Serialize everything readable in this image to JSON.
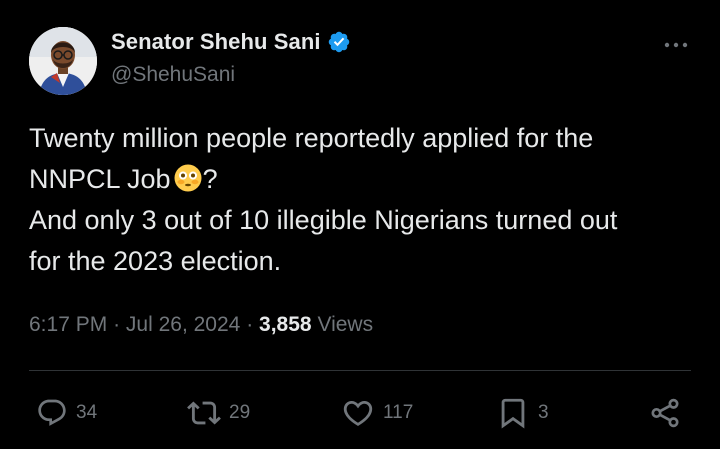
{
  "author": {
    "name": "Senator Shehu Sani",
    "handle": "@ShehuSani",
    "verified": true,
    "avatar_icon": "profile-photo"
  },
  "tweet": {
    "lines": [
      "Twenty million people reportedly applied for the",
      "NNPCL Job",
      "?",
      "And only 3 out of 10 illegible Nigerians turned out",
      "for the 2023 election."
    ],
    "emoji": "flushed-face-icon"
  },
  "meta": {
    "time": "6:17 PM",
    "separator": "·",
    "date": "Jul 26, 2024",
    "views_count": "3,858",
    "views_label": "Views"
  },
  "actions": {
    "replies": "34",
    "reposts": "29",
    "likes": "117",
    "bookmarks": "3"
  },
  "colors": {
    "background": "#000000",
    "text": "#e7e9ea",
    "secondary": "#71767b",
    "verified": "#1d9bf0",
    "divider": "#2f3336"
  }
}
